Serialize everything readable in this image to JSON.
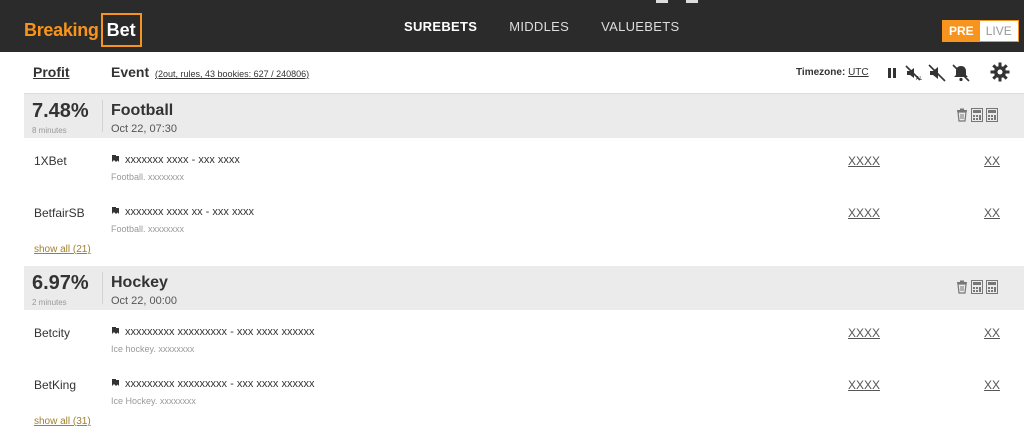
{
  "brand": {
    "part1": "Breaking",
    "part2": "Bet"
  },
  "nav": [
    {
      "label": "SUREBETS",
      "active": true
    },
    {
      "label": "MIDDLES",
      "active": false
    },
    {
      "label": "VALUEBETS",
      "active": false
    }
  ],
  "toggle": {
    "pre": "PRE",
    "live": "LIVE"
  },
  "header": {
    "profit": "Profit",
    "event": "Event",
    "event_sub": "(2out, rules, 43 bookies: 627 / 240806)",
    "timezone_label": "Timezone:",
    "timezone_value": "UTC"
  },
  "groups": [
    {
      "percent": "7.48%",
      "age": "8 minutes",
      "sport": "Football",
      "date": "Oct 22, 07:30",
      "rows": [
        {
          "bookie": "1XBet",
          "event": "xxxxxxx xxxx - xxx xxxx",
          "sub": "Football. xxxxxxxx",
          "market": "XXXX",
          "odds": "XX"
        },
        {
          "bookie": "BetfairSB",
          "event": "xxxxxxx xxxx xx - xxx xxxx",
          "sub": "Football. xxxxxxxx",
          "market": "XXXX",
          "odds": "XX"
        }
      ],
      "show_all": "show all (21)"
    },
    {
      "percent": "6.97%",
      "age": "2 minutes",
      "sport": "Hockey",
      "date": "Oct 22, 00:00",
      "rows": [
        {
          "bookie": "Betcity",
          "event": "xxxxxxxxx xxxxxxxxx - xxx xxxx xxxxxx",
          "sub": "Ice hockey. xxxxxxxx",
          "market": "XXXX",
          "odds": "XX"
        },
        {
          "bookie": "BetKing",
          "event": "xxxxxxxxx xxxxxxxxx - xxx xxxx xxxxxx",
          "sub": "Ice Hockey. xxxxxxxx",
          "market": "XXXX",
          "odds": "XX"
        }
      ],
      "show_all": "show all (31)"
    }
  ],
  "icons": {
    "header": [
      "pause-icon",
      "no-sound-filter-icon",
      "mute-icon",
      "bell-icon",
      "gear-icon"
    ],
    "group": [
      "trash-icon",
      "calculator-icon",
      "calculator-icon"
    ],
    "row": "bookmark-icon"
  },
  "colors": {
    "accent": "#f7941d",
    "topbar": "#2b2b2b",
    "group_bg": "#ebebeb",
    "link": "#a0812d"
  }
}
